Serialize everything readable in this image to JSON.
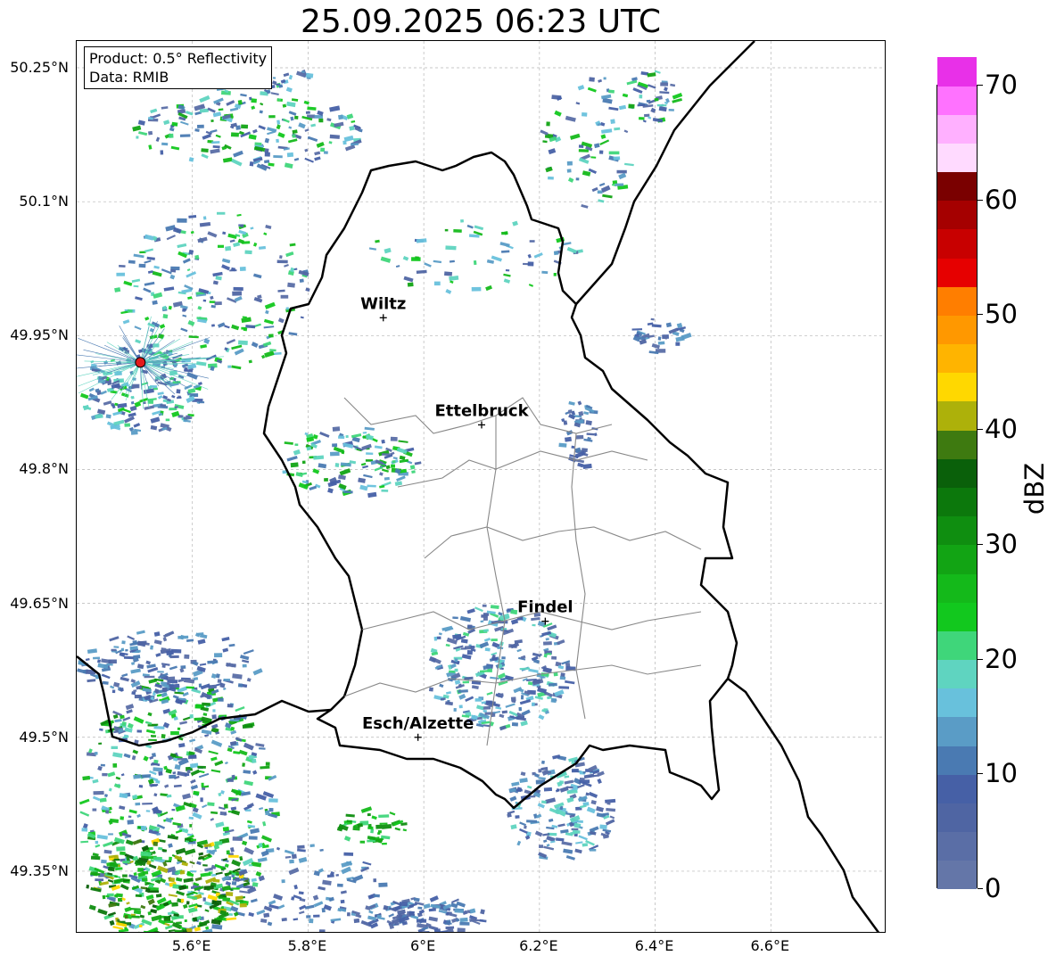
{
  "title": "25.09.2025 06:23 UTC",
  "info": {
    "product": "Product: 0.5° Reflectivity",
    "data": "Data: RMIB"
  },
  "y_ticks": [
    {
      "value": 50.25,
      "label": "50.25°N"
    },
    {
      "value": 50.1,
      "label": "50.1°N"
    },
    {
      "value": 49.95,
      "label": "49.95°N"
    },
    {
      "value": 49.8,
      "label": "49.8°N"
    },
    {
      "value": 49.65,
      "label": "49.65°N"
    },
    {
      "value": 49.5,
      "label": "49.5°N"
    },
    {
      "value": 49.35,
      "label": "49.35°N"
    }
  ],
  "x_ticks": [
    {
      "value": 5.6,
      "label": "5.6°E"
    },
    {
      "value": 5.8,
      "label": "5.8°E"
    },
    {
      "value": 6.0,
      "label": "6°E"
    },
    {
      "value": 6.2,
      "label": "6.2°E"
    },
    {
      "value": 6.4,
      "label": "6.4°E"
    },
    {
      "value": 6.6,
      "label": "6.6°E"
    }
  ],
  "cities": [
    {
      "name": "Wiltz",
      "lon": 5.93,
      "lat": 49.97
    },
    {
      "name": "Ettelbruck",
      "lon": 6.1,
      "lat": 49.85
    },
    {
      "name": "Findel",
      "lon": 6.21,
      "lat": 49.63
    },
    {
      "name": "Esch/Alzette",
      "lon": 5.99,
      "lat": 49.5
    }
  ],
  "radar_site": {
    "lon": 5.51,
    "lat": 49.92,
    "color": "#e31a1c"
  },
  "colorbar": {
    "label": "dBZ",
    "ticks": [
      {
        "value": 0,
        "label": "0"
      },
      {
        "value": 10,
        "label": "10"
      },
      {
        "value": 20,
        "label": "20"
      },
      {
        "value": 30,
        "label": "30"
      },
      {
        "value": 40,
        "label": "40"
      },
      {
        "value": 50,
        "label": "50"
      },
      {
        "value": 60,
        "label": "60"
      },
      {
        "value": 70,
        "label": "70"
      }
    ],
    "min": 0,
    "max": 70,
    "step": 2.5,
    "colors": [
      "#6476a8",
      "#5a6ea6",
      "#4f65a3",
      "#4660a6",
      "#4a7ab2",
      "#5a9cc6",
      "#68c1dc",
      "#5fd4c0",
      "#3fd67a",
      "#12c81e",
      "#14b91a",
      "#12a414",
      "#0f8e10",
      "#0c780c",
      "#0a600a",
      "#3e7a10",
      "#adb10a",
      "#ffd800",
      "#ffb400",
      "#ff9800",
      "#ff7e00",
      "#e60000",
      "#c80000",
      "#a50000",
      "#7a0000",
      "#ffdaff",
      "#ffb0ff",
      "#ff72ff",
      "#e830e8"
    ]
  },
  "chart_data": {
    "type": "map",
    "title": "25.09.2025 06:23 UTC",
    "lon_range": [
      5.4,
      6.8
    ],
    "lat_range": [
      49.28,
      50.28
    ],
    "grid": true,
    "legend": "colorbar right"
  }
}
